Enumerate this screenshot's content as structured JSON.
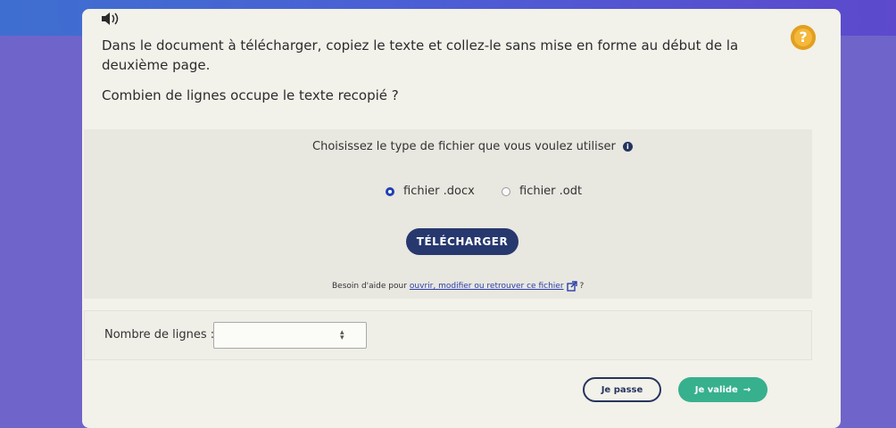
{
  "question": {
    "text": "Dans le document à télécharger, copiez le texte et collez-le sans mise en forme au début de la deuxième page.",
    "sub": "Combien de lignes occupe le texte recopié ?"
  },
  "download": {
    "prompt": "Choisissez le type de fichier que vous voulez utiliser",
    "options": [
      {
        "label": "fichier .docx",
        "selected": true
      },
      {
        "label": "fichier .odt",
        "selected": false
      }
    ],
    "button": "TÉLÉCHARGER",
    "help_prefix": "Besoin d'aide pour ",
    "help_link": "ouvrir, modifier ou retrouver ce fichier",
    "help_suffix": " ?"
  },
  "answer": {
    "label": "Nombre de lignes :",
    "value": ""
  },
  "actions": {
    "skip": "Je passe",
    "validate": "Je valide",
    "validate_arrow": "→"
  },
  "colors": {
    "primary": "#27386e",
    "accent": "#37b08e",
    "help_badge": "#f4b83c"
  },
  "icons": {
    "sound": "speaker-icon",
    "help": "question-mark-icon",
    "info": "info-icon",
    "external": "external-link-icon",
    "arrow": "arrow-right-icon"
  }
}
